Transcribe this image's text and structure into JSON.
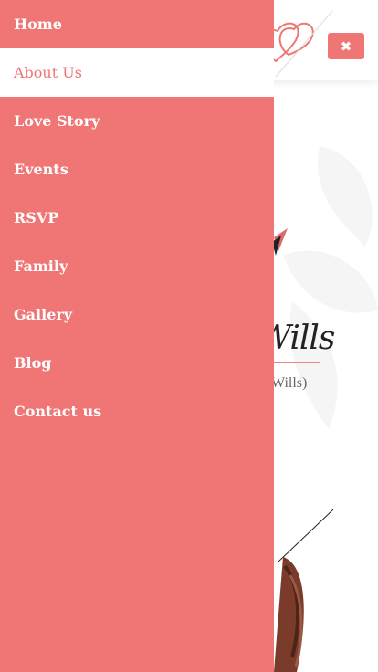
{
  "colors": {
    "accent": "#f07575",
    "text_light": "#ffffff",
    "page_bg": "#ffffff"
  },
  "header": {
    "close_icon": "✖"
  },
  "content": {
    "names_script": "Wills",
    "names_sub": "Wills)"
  },
  "menu": {
    "items": [
      {
        "label": "Home",
        "active": false
      },
      {
        "label": "About Us",
        "active": true
      },
      {
        "label": "Love Story",
        "active": false
      },
      {
        "label": "Events",
        "active": false
      },
      {
        "label": "RSVP",
        "active": false
      },
      {
        "label": "Family",
        "active": false
      },
      {
        "label": "Gallery",
        "active": false
      },
      {
        "label": "Blog",
        "active": false
      },
      {
        "label": "Contact us",
        "active": false
      }
    ]
  }
}
